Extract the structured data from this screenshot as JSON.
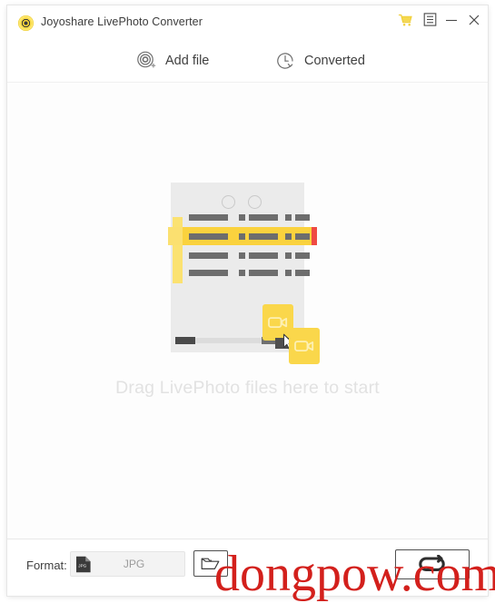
{
  "window": {
    "title": "Joyoshare LivePhoto Converter",
    "logo_icon": "joyoshare-logo-icon",
    "controls": {
      "cart": {
        "icon": "shopping-cart-icon",
        "label": "Buy"
      },
      "menu": {
        "icon": "menu-list-icon",
        "label": "Menu"
      },
      "minimize": {
        "icon": "minimize-icon",
        "label": "Minimize"
      },
      "close": {
        "icon": "close-icon",
        "label": "Close"
      }
    }
  },
  "toolbar": {
    "add_file": {
      "label": "Add file",
      "icon": "add-file-target-icon"
    },
    "converted": {
      "label": "Converted",
      "icon": "clock-history-icon"
    }
  },
  "drop_area": {
    "hint": "Drag LivePhoto files here to start",
    "illustration": {
      "name": "drag-drop-illustration",
      "card_icon": "video-camera-icon",
      "cursor_icon": "drag-cursor-icon",
      "rows": 4,
      "highlighted_row_index": 1,
      "accent_color": "#ef4a44",
      "highlight_color": "#fad23e",
      "card_color": "#fad74b"
    }
  },
  "bottom_bar": {
    "format_label": "Format:",
    "format_value": "JPG",
    "format_icon": "jpg-file-icon",
    "folder_button": {
      "icon": "folder-open-icon",
      "label": "Open output folder"
    },
    "convert_button": {
      "icon": "convert-loop-icon",
      "label": "Convert"
    }
  },
  "watermark": {
    "text": "dongpow.com",
    "color": "#d3201c"
  }
}
